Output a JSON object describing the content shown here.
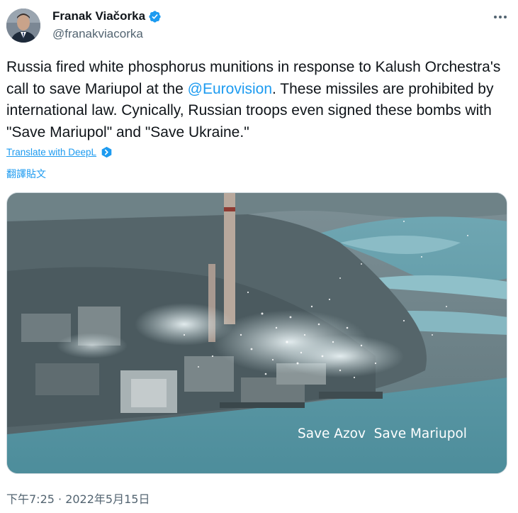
{
  "author": {
    "display_name": "Franak Viačorka",
    "handle": "@franakviacorka",
    "verified": true,
    "avatar_icon": "avatar-photo-icon",
    "verified_icon": "verified-badge-icon",
    "more_icon": "more-options-icon"
  },
  "tweet": {
    "text_before_mention": "Russia fired white phosphorus munitions in response to Kalush Orchestra's call to save Mariupol at the ",
    "mention": "@Eurovision",
    "text_after_mention": ". These missiles are prohibited by international law. Cynically, Russian troops even signed these bombs with \"Save Mariupol\" and \"Save Ukraine.\"",
    "translate_label": "Translate with DeepL",
    "translate_icon": "deepl-icon",
    "translate_cjk_label": "翻譯貼文",
    "media_caption": "Save Azov  Save Mariupol",
    "timestamp": "下午7:25 · 2022年5月15日"
  },
  "colors": {
    "link": "#1d9bf0",
    "secondary_text": "#536471",
    "primary_text": "#0f1419",
    "verified": "#1d9bf0"
  }
}
